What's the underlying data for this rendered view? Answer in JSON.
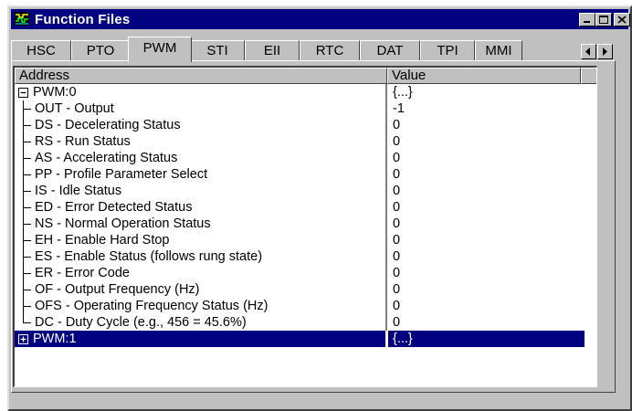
{
  "window": {
    "title": "Function Files"
  },
  "tabs": [
    {
      "label": "HSC",
      "active": false
    },
    {
      "label": "PTO",
      "active": false
    },
    {
      "label": "PWM",
      "active": true
    },
    {
      "label": "STI",
      "active": false
    },
    {
      "label": "EII",
      "active": false
    },
    {
      "label": "RTC",
      "active": false
    },
    {
      "label": "DAT",
      "active": false
    },
    {
      "label": "TPI",
      "active": false
    },
    {
      "label": "MMI",
      "active": false
    }
  ],
  "grid": {
    "columns": [
      "Address",
      "Value"
    ],
    "rows": [
      {
        "address": "PWM:0",
        "value": "{...}",
        "level": 0,
        "expander": "minus"
      },
      {
        "address": "OUT - Output",
        "value": "-1",
        "level": 1
      },
      {
        "address": "DS - Decelerating Status",
        "value": "0",
        "level": 1
      },
      {
        "address": "RS - Run Status",
        "value": "0",
        "level": 1
      },
      {
        "address": "AS - Accelerating Status",
        "value": "0",
        "level": 1
      },
      {
        "address": "PP - Profile Parameter Select",
        "value": "0",
        "level": 1
      },
      {
        "address": "IS - Idle Status",
        "value": "0",
        "level": 1
      },
      {
        "address": "ED - Error Detected Status",
        "value": "0",
        "level": 1
      },
      {
        "address": "NS - Normal Operation Status",
        "value": "0",
        "level": 1
      },
      {
        "address": "EH - Enable Hard Stop",
        "value": "0",
        "level": 1
      },
      {
        "address": "ES - Enable Status (follows rung state)",
        "value": "0",
        "level": 1
      },
      {
        "address": "ER - Error Code",
        "value": "0",
        "level": 1
      },
      {
        "address": "OF - Output Frequency (Hz)",
        "value": "0",
        "level": 1
      },
      {
        "address": "OFS - Operating Frequency Status (Hz)",
        "value": "0",
        "level": 1
      },
      {
        "address": "DC - Duty Cycle (e.g., 456 = 45.6%)",
        "value": "0",
        "level": 1,
        "last": true
      },
      {
        "address": "PWM:1",
        "value": "{...}",
        "level": 0,
        "expander": "plus",
        "selected": true
      }
    ]
  },
  "colors": {
    "titlebar": "#000080",
    "face": "#c0c0c0",
    "selection": "#000080"
  }
}
